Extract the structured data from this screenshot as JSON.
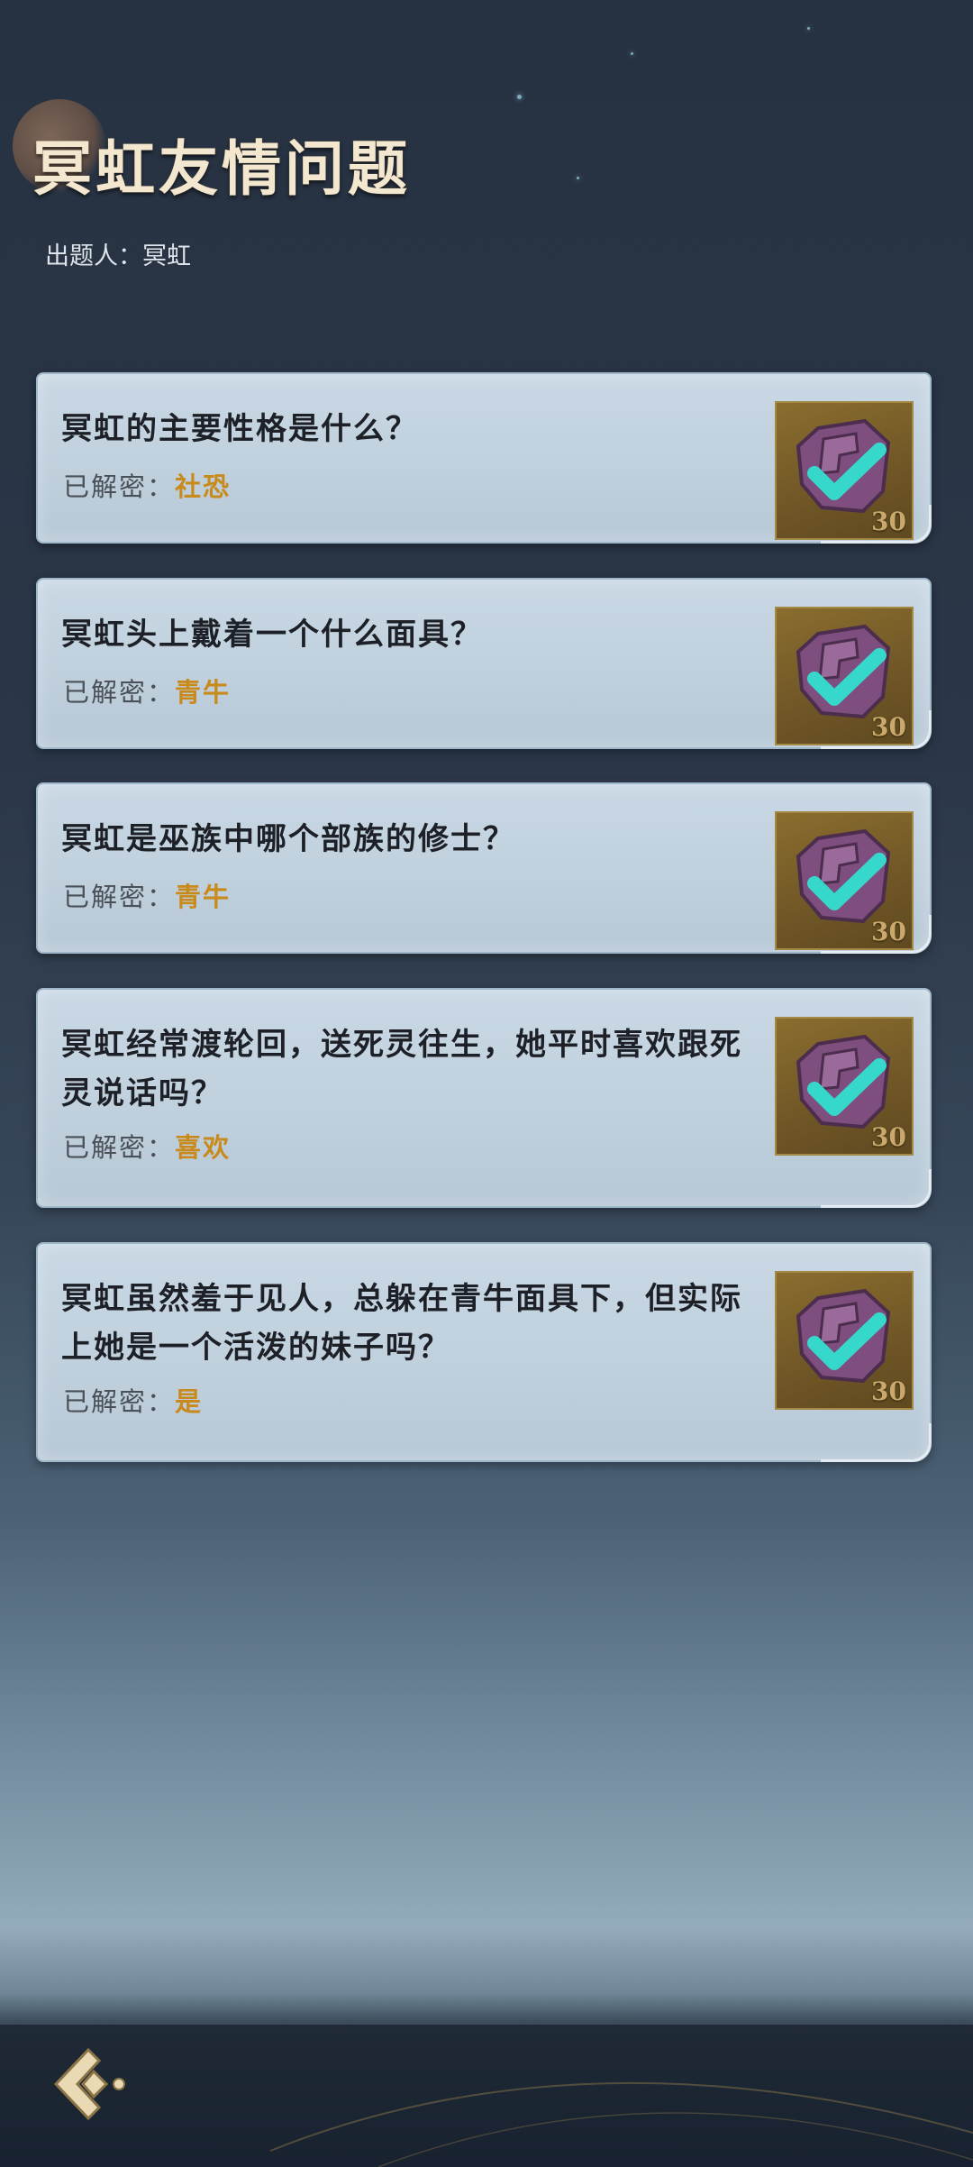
{
  "header": {
    "title": "冥虹友情问题",
    "asker_label": "出题人：",
    "asker_name": "冥虹"
  },
  "answer_prefix": "已解密：",
  "questions": [
    {
      "text": "冥虹的主要性格是什么？",
      "answer": "社恐",
      "reward": "30"
    },
    {
      "text": "冥虹头上戴着一个什么面具？",
      "answer": "青牛",
      "reward": "30"
    },
    {
      "text": "冥虹是巫族中哪个部族的修士？",
      "answer": "青牛",
      "reward": "30"
    },
    {
      "text": "冥虹经常渡轮回，送死灵往生，她平时喜欢跟死灵说话吗？",
      "answer": "喜欢",
      "reward": "30"
    },
    {
      "text": "冥虹虽然羞于见人，总躲在青牛面具下，但实际上她是一个活泼的妹子吗？",
      "answer": "是",
      "reward": "30"
    }
  ],
  "icons": {
    "badge": "solved-check-badge-icon",
    "back": "back-arrow-icon"
  },
  "colors": {
    "answer_value": "#c98a1c",
    "check_mark": "#37d8cc",
    "badge_gem": "#7d4e7e",
    "title": "#f3e7cf"
  }
}
